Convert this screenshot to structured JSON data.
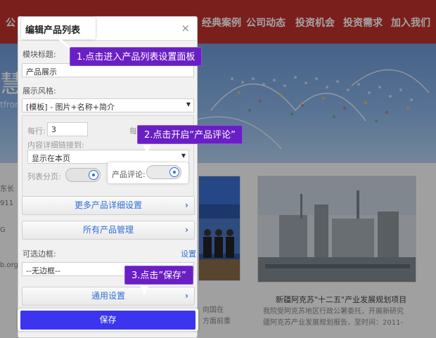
{
  "site": {
    "nav": [
      "公",
      "经典案例",
      "公司动态",
      "投资机会",
      "投资需求",
      "加入我们"
    ],
    "banner_char": "慧",
    "banner_sub": "tfrom",
    "addr": [
      "东长",
      "911",
      "G",
      "b.org"
    ],
    "card2_caption": "新疆阿克苏\"十二五\"产业发展规划项目",
    "card2_desc1": "我院受阿克苏地区行政公署委托，开展新研究",
    "card2_desc2": "疆阿克苏产业发展规划报告，至时间：2011-",
    "card1_desc1": "向国在",
    "card1_desc2": "方面前重"
  },
  "dialog": {
    "title": "编辑产品列表",
    "close": "×",
    "module_title_label": "模块标题:",
    "module_title_value": "产品展示",
    "style_label": "展示风格:",
    "style_value": "[模板] - 图片+名称+简介",
    "per_row_label": "每行:",
    "per_row_value": "3",
    "per_row_cut": "每",
    "detail_link_label": "内容详细链接到:",
    "detail_link_value": "显示在本页",
    "pagination_label": "列表分页:",
    "review_label": "产品评论:",
    "more_detail": "更多产品详细设置",
    "all_products": "所有产品管理",
    "optional_frame_label": "可选边框:",
    "frame_settings": "设置",
    "frame_value": "--无边框--",
    "general_settings": "通用设置",
    "save": "保存",
    "chevron": "›",
    "caret": "▼"
  },
  "tips": {
    "step1": "1.点击进入产品列表设置面板",
    "step2": "2.点击开启“产品评论”",
    "step3": "3.点击”保存”"
  },
  "colors": {
    "nav_red": "#c0312d",
    "tooltip_purple": "#6a1fc4",
    "save_blue": "#3b35f0",
    "link_blue": "#2f6fd6"
  }
}
